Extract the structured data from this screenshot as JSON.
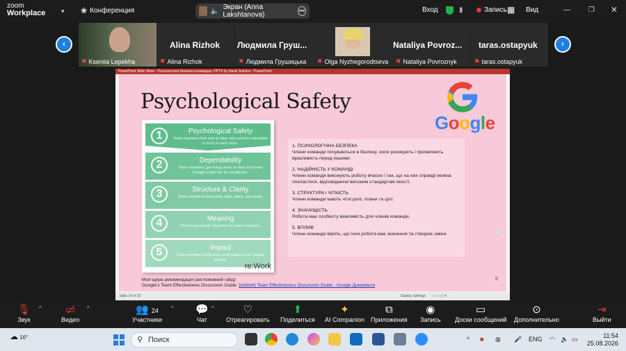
{
  "app": {
    "logo_line1": "zoom",
    "logo_line2": "Workplace",
    "conference_label": "Конференция",
    "screen_share_label": "Экран (Anna Lakshtanova)",
    "signin_label": "Вход",
    "record_label": "Запись",
    "view_label": "Вид"
  },
  "participants": [
    {
      "display": "",
      "label": "Kseniia Lepekha"
    },
    {
      "display": "Alina Rizhok",
      "label": "Alina Rizhok"
    },
    {
      "display": "Людмила  Груш...",
      "label": "Людмила Грушицька"
    },
    {
      "display": "",
      "label": "Olga Nyzhegorodtseva"
    },
    {
      "display": "Nataliya  Povroz...",
      "label": "Nataliya Povroznyk"
    },
    {
      "display": "taras.ostapyuk",
      "label": "taras.ostapyuk"
    }
  ],
  "window": {
    "title": "PowerPoint Slide Show - Психологічна безпека в командах .PPTX by Danik Sokolov - PowerPoint",
    "status_slide": "Slide 14 of 32",
    "status_display": "Display Settings"
  },
  "slide": {
    "title": "Psychological Safety",
    "google_word": "Google",
    "card": [
      {
        "num": "1",
        "head": "Psychological Safety",
        "desc": "Team members feel safe to take risks and be vulnerable in front of each other.",
        "color": "#5fbc8c"
      },
      {
        "num": "2",
        "head": "Dependability",
        "desc": "Team members get things done on time and meet Google's high bar for excellence.",
        "color": "#70c49a"
      },
      {
        "num": "3",
        "head": "Structure & Clarity",
        "desc": "Team members have clear roles, plans, and goals.",
        "color": "#80cba6"
      },
      {
        "num": "4",
        "head": "Meaning",
        "desc": "Work is personally important to team members.",
        "color": "#90d2b1"
      },
      {
        "num": "5",
        "head": "Impact",
        "desc": "Team members think their work matters and creates change.",
        "color": "#a0d9bc"
      }
    ],
    "card_brand": "re:Work",
    "text_items": [
      {
        "head": "1.   ПСИХОЛОГІЧНА БЕЗПЕКА",
        "body": "Члени команди почуваються в безпеці, коли ризикують і проявляють вразливість перед іншими."
      },
      {
        "head": "2. НАДІЙНІСТЬ У КОМАНДІ",
        "body": "Члени команди виконують роботу вчасно і так, що на них справді можна покластися, відповідаючи високим стандартам якості."
      },
      {
        "head": "3. СТРУКТУРА і ЧІТКІСТЬ",
        "body": "Члени команди мають чіткі ролі, плани та цілі."
      },
      {
        "head": "4. ЗНАЧУЩІСТЬ",
        "body": "Робота має особисту важливість для членів команди."
      },
      {
        "head": "5. ВПЛИВ",
        "body": "Члени команди вірять, що їхня робота має значення та створює зміни."
      }
    ],
    "rec_line1": "Моя щира рекомендація (англомовний гайд):",
    "rec_line2_prefix": "Google's Team Effectiveness Discussion Guide: ",
    "rec_link": "[reWork] Team Effectiveness Discussion Guide - Google Документи",
    "page_number": "5"
  },
  "toolbar": {
    "sound": "Звук",
    "video": "Видео",
    "participants": "Участники",
    "participants_count": "24",
    "chat": "Чат",
    "react": "Отреагировать",
    "share": "Поделиться",
    "ai": "AI Companion",
    "apps": "Приложения",
    "record": "Запись",
    "boards": "Доски сообщений",
    "more": "Дополнительно",
    "exit": "Выйти"
  },
  "taskbar": {
    "weather": "16°",
    "search_placeholder": "Поиск",
    "lang": "ENG",
    "time": "11:54",
    "date": "25.08.2026"
  }
}
